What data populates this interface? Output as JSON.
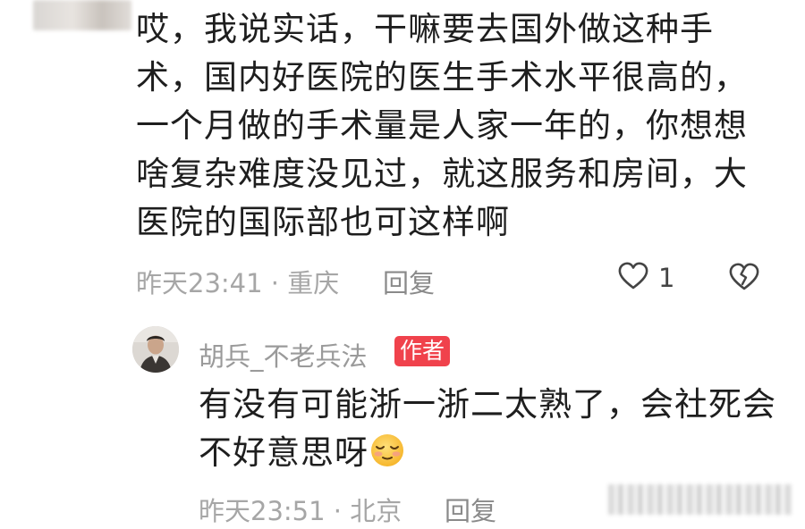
{
  "comment": {
    "lines": [
      "哎，我说实话，干嘛要去国外做这种手",
      "术，国内好医院的医生手术水平很高的，",
      "一个月做的手术量是人家一年的，你想想",
      "啥复杂难度没见过，就这服务和房间，大",
      "医院的国际部也可这样啊"
    ],
    "meta": "昨天23:41 · 重庆",
    "reply_label": "回复",
    "like_count": "1",
    "like_icon": "heart-outline-icon",
    "dislike_icon": "broken-heart-icon"
  },
  "reply": {
    "author": "胡兵_不老兵法",
    "badge": "作者",
    "lines": [
      "有没有可能浙一浙二太熟了，会社死会",
      "不好意思呀"
    ],
    "emoji": "shy-smile-emoji",
    "meta": "昨天23:51 · 北京",
    "reply_label": "回复"
  },
  "colors": {
    "text": "#1e1e1e",
    "meta": "#a6a6a6",
    "badge_bg": "#f0424c",
    "badge_text": "#ffffff"
  }
}
